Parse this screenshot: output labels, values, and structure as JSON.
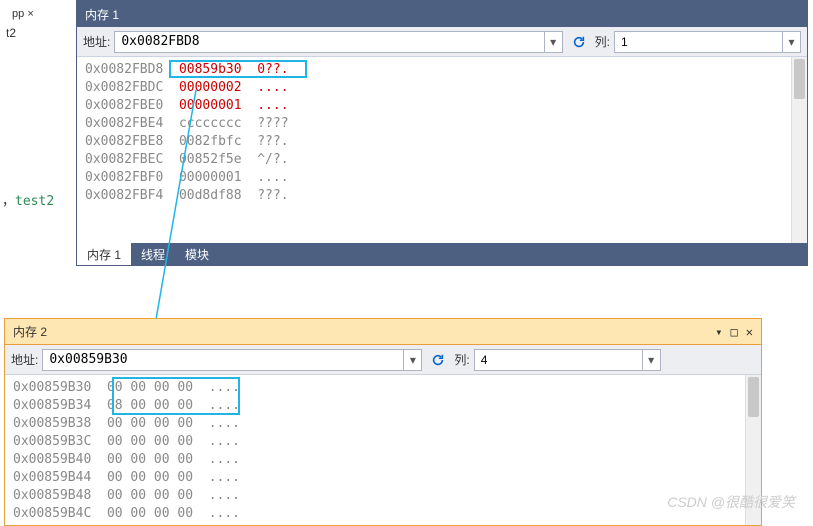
{
  "left": {
    "tab_pp": "pp",
    "tab_close": "×",
    "tab_t2": "t2",
    "comma": "，",
    "test2": "test2"
  },
  "panel1": {
    "title": "内存 1",
    "addr_label": "地址:",
    "addr_value": "0x0082FBD8",
    "col_label": "列:",
    "col_value": "1",
    "tabs": {
      "mem": "内存 1",
      "thread": "线程",
      "module": "模块"
    },
    "rows": [
      {
        "addr": "0x0082FBD8",
        "hex": "00859b30",
        "ascii": "0??.",
        "red": true
      },
      {
        "addr": "0x0082FBDC",
        "hex": "00000002",
        "ascii": "....",
        "red": true
      },
      {
        "addr": "0x0082FBE0",
        "hex": "00000001",
        "ascii": "....",
        "red": true
      },
      {
        "addr": "0x0082FBE4",
        "hex": "cccccccc",
        "ascii": "????",
        "red": false
      },
      {
        "addr": "0x0082FBE8",
        "hex": "0082fbfc",
        "ascii": "???.",
        "red": false
      },
      {
        "addr": "0x0082FBEC",
        "hex": "00852f5e",
        "ascii": "^/?.",
        "red": false
      },
      {
        "addr": "0x0082FBF0",
        "hex": "00000001",
        "ascii": "....",
        "red": false
      },
      {
        "addr": "0x0082FBF4",
        "hex": "00d8df88",
        "ascii": "???.",
        "red": false
      }
    ]
  },
  "panel2": {
    "title": "内存 2",
    "addr_label": "地址:",
    "addr_value": "0x00859B30",
    "col_label": "列:",
    "col_value": "4",
    "win": {
      "min": "▾",
      "restore": "□",
      "close": "✕"
    },
    "rows": [
      {
        "addr": "0x00859B30",
        "hex": "00 00 00 00",
        "ascii": "....",
        "red": false
      },
      {
        "addr": "0x00859B34",
        "hex": "08 00 00 00",
        "ascii": "....",
        "red": false
      },
      {
        "addr": "0x00859B38",
        "hex": "00 00 00 00",
        "ascii": "....",
        "red": false
      },
      {
        "addr": "0x00859B3C",
        "hex": "00 00 00 00",
        "ascii": "....",
        "red": false
      },
      {
        "addr": "0x00859B40",
        "hex": "00 00 00 00",
        "ascii": "....",
        "red": false
      },
      {
        "addr": "0x00859B44",
        "hex": "00 00 00 00",
        "ascii": "....",
        "red": false
      },
      {
        "addr": "0x00859B48",
        "hex": "00 00 00 00",
        "ascii": "....",
        "red": false
      },
      {
        "addr": "0x00859B4C",
        "hex": "00 00 00 00",
        "ascii": "....",
        "red": false
      }
    ]
  },
  "watermark": "CSDN @很酷很爱笑"
}
